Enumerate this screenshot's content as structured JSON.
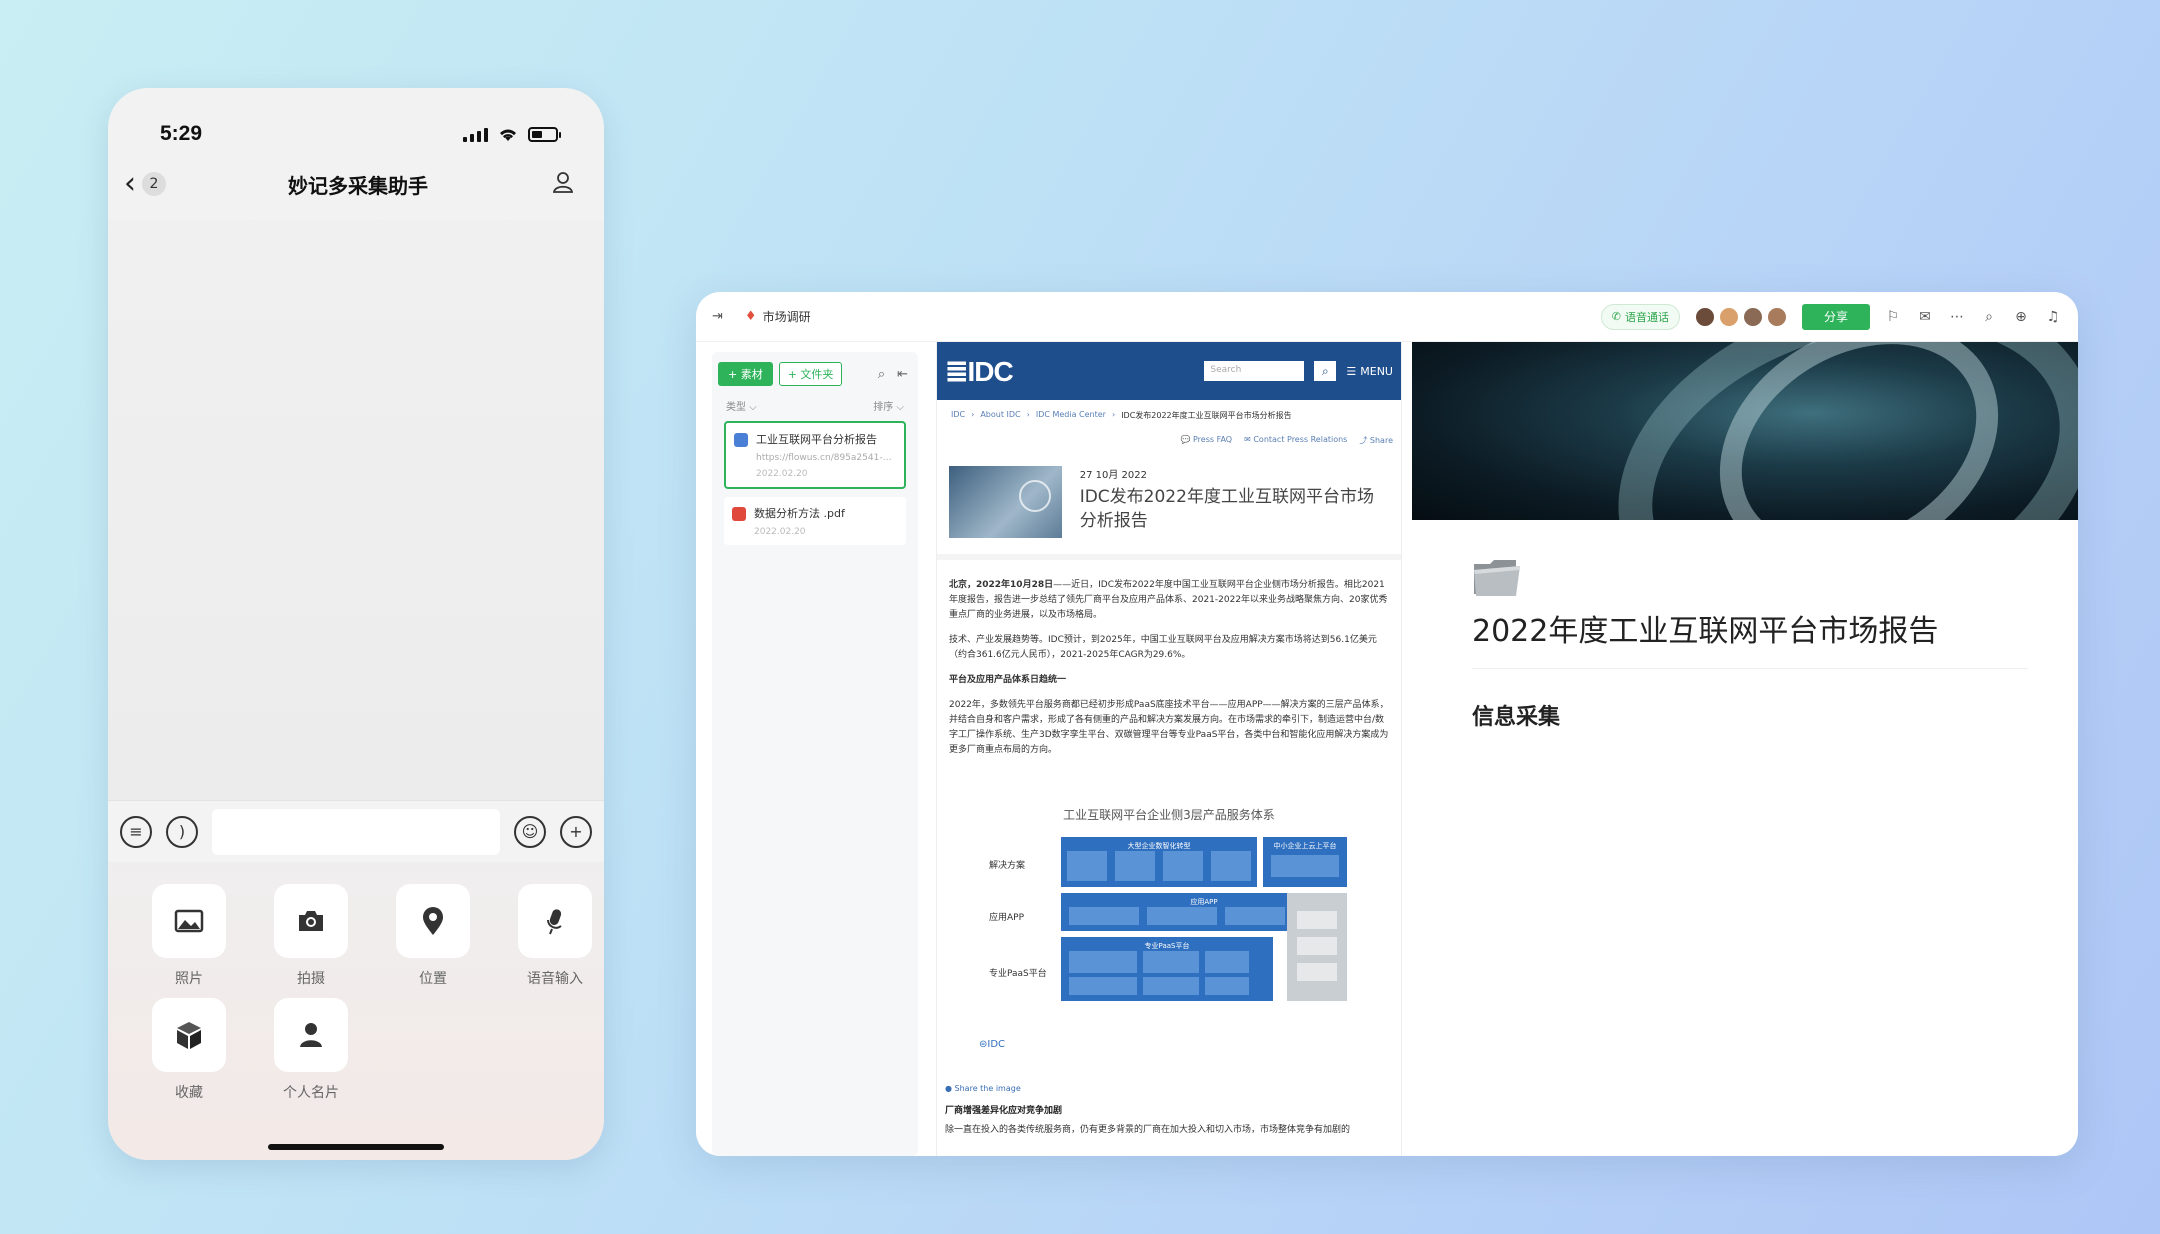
{
  "phone": {
    "time": "5:29",
    "back_count": "2",
    "title": "妙记多采集助手",
    "panel": [
      {
        "label": "照片",
        "icon": "image-icon"
      },
      {
        "label": "拍摄",
        "icon": "camera-icon"
      },
      {
        "label": "位置",
        "icon": "location-icon"
      },
      {
        "label": "语音输入",
        "icon": "microphone-icon"
      },
      {
        "label": "收藏",
        "icon": "cube-icon"
      },
      {
        "label": "个人名片",
        "icon": "contact-card-icon"
      }
    ]
  },
  "app": {
    "breadcrumb": "市场调研",
    "voice_call": "语音通话",
    "share": "分享",
    "sidebar": {
      "add_material": "+ 素材",
      "add_folder": "+ 文件夹",
      "filter_type": "类型 ⌵",
      "filter_sort": "排序 ⌵",
      "items": [
        {
          "title": "工业互联网平台分析报告",
          "url": "https://flowus.cn/895a2541-a64f...",
          "date": "2022.02.20"
        },
        {
          "title": "数据分析方法 .pdf",
          "url": "",
          "date": "2022.02.20"
        }
      ]
    },
    "web": {
      "search_placeholder": "Search",
      "menu": "MENU",
      "crumbs": [
        "IDC",
        "About IDC",
        "IDC Media Center",
        "IDC发布2022年度工业互联网平台市场分析报告"
      ],
      "press_faq": "Press FAQ",
      "contact": "Contact Press Relations",
      "share": "Share",
      "date": "27 10月 2022",
      "title": "IDC发布2022年度工业互联网平台市场分析报告",
      "p1_bold": "北京，2022年10月28日",
      "p1": "——近日，IDC发布2022年度中国工业互联网平台企业侧市场分析报告。相比2021年度报告，报告进一步总结了领先厂商平台及应用产品体系、2021-2022年以来业务战略聚焦方向、20家优秀重点厂商的业务进展，以及市场格局。",
      "p2": "技术、产业发展趋势等。IDC预计，到2025年，中国工业互联网平台及应用解决方案市场将达到56.1亿美元（约合361.6亿元人民币），2021-2025年CAGR为29.6%。",
      "h1": "平台及应用产品体系日趋统一",
      "p3": "2022年，多数领先平台服务商都已经初步形成PaaS底座技术平台——应用APP——解决方案的三层产品体系，并结合自身和客户需求，形成了各有侧重的产品和解决方案发展方向。在市场需求的牵引下，制造运营中台/数字工厂操作系统、生产3D数字孪生平台、双碳管理平台等专业PaaS平台，各类中台和智能化应用解决方案成为更多厂商重点布局的方向。",
      "fig_title": "工业互联网平台企业侧3层产品服务体系",
      "fig_rows": [
        "解决方案",
        "应用APP",
        "专业PaaS平台"
      ],
      "fig_blocks": [
        "大型企业数智化转型",
        "中小企业上云上平台",
        "应用APP",
        "专业PaaS平台"
      ],
      "fig_logo": "⊜IDC",
      "share_image": "Share the image",
      "h2": "厂商增强差异化应对竞争加剧",
      "p4": "除一直在投入的各类传统服务商，仍有更多背景的厂商在加大投入和切入市场，市场整体竞争有加剧的"
    },
    "doc": {
      "title": "2022年度工业互联网平台市场报告",
      "section": "信息采集"
    }
  }
}
